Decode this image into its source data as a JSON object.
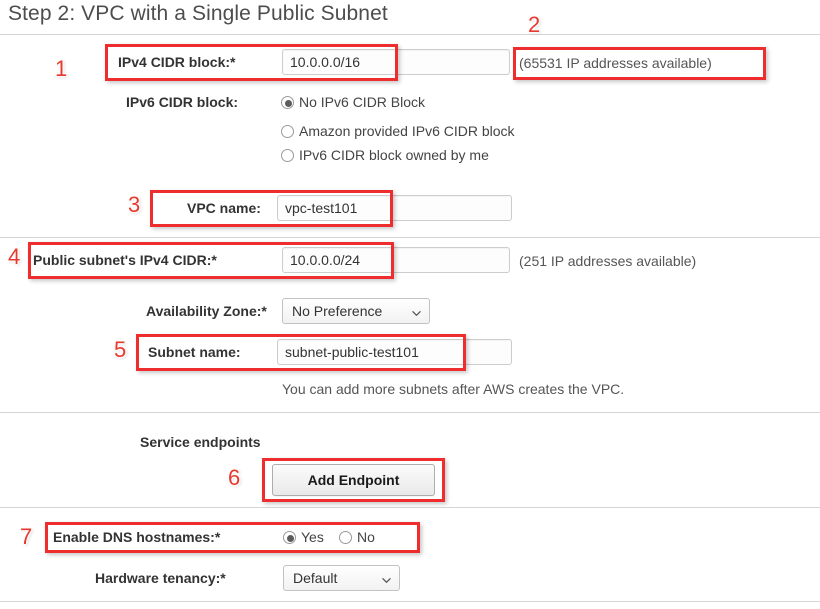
{
  "header": {
    "title": "Step 2: VPC with a Single Public Subnet"
  },
  "form": {
    "ipv4_cidr": {
      "label": "IPv4 CIDR block:*",
      "value": "10.0.0.0/16",
      "availability": "(65531 IP addresses available)"
    },
    "ipv6_cidr": {
      "label": "IPv6 CIDR block:",
      "options": [
        {
          "label": "No IPv6 CIDR Block",
          "selected": true
        },
        {
          "label": "Amazon provided IPv6 CIDR block",
          "selected": false
        },
        {
          "label": "IPv6 CIDR block owned by me",
          "selected": false
        }
      ]
    },
    "vpc_name": {
      "label": "VPC name:",
      "value": "vpc-test101"
    },
    "public_subnet_cidr": {
      "label": "Public subnet's IPv4 CIDR:*",
      "value": "10.0.0.0/24",
      "availability": "(251 IP addresses available)"
    },
    "availability_zone": {
      "label": "Availability Zone:*",
      "value": "No Preference",
      "options": [
        "No Preference"
      ]
    },
    "subnet_name": {
      "label": "Subnet name:",
      "value": "subnet-public-test101",
      "hint": "You can add more subnets after AWS creates the VPC."
    },
    "service_endpoints": {
      "label": "Service endpoints",
      "add_endpoint_label": "Add Endpoint"
    },
    "dns_hostnames": {
      "label": "Enable DNS hostnames:*",
      "options": [
        {
          "label": "Yes",
          "selected": true
        },
        {
          "label": "No",
          "selected": false
        }
      ]
    },
    "hardware_tenancy": {
      "label": "Hardware tenancy:*",
      "value": "Default",
      "options": [
        "Default"
      ]
    }
  },
  "annotations": {
    "numbers": [
      "1",
      "2",
      "3",
      "4",
      "5",
      "6",
      "7"
    ]
  },
  "colors": {
    "annotation_red": "#ee2e2e",
    "text": "#333333",
    "divider": "#d5d5d5"
  }
}
